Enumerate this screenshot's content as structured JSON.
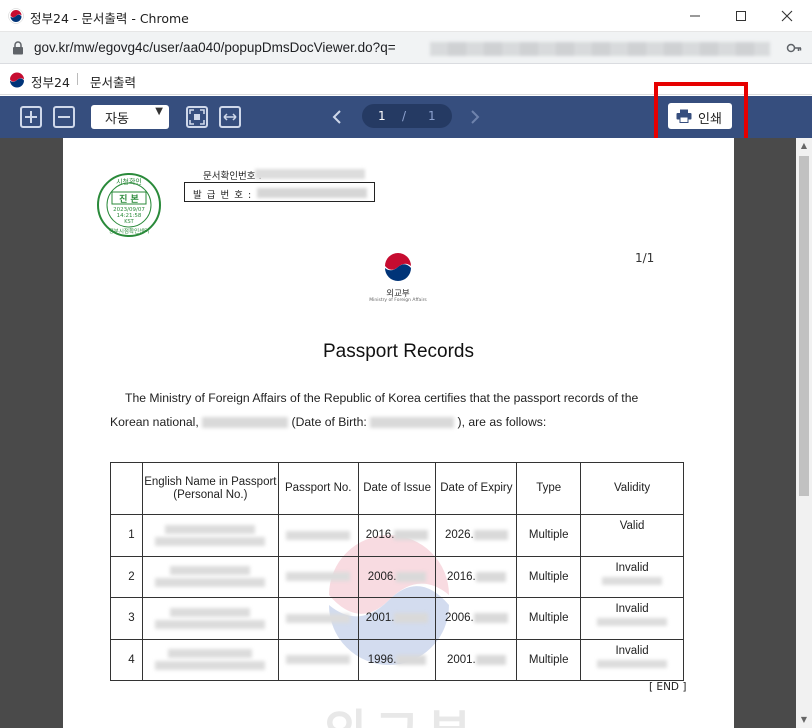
{
  "window": {
    "title": "정부24 - 문서출력 - Chrome",
    "controls": [
      "minimize",
      "maximize",
      "close"
    ]
  },
  "address": {
    "url": "gov.kr/mw/egovg4c/user/aa040/popupDmsDocViewer.do?q="
  },
  "header": {
    "site": "정부24",
    "page": "문서출력"
  },
  "toolbar": {
    "zoom": "자동",
    "current_page": "1",
    "page_sep": "/",
    "total_pages": "1",
    "print_label": "인쇄"
  },
  "document": {
    "seal": {
      "top_text": "시청확인",
      "center": "진 본",
      "date": "2023/09/07",
      "time": "14:21:58",
      "zone": "KST",
      "bottom_text": "정부시점확인센터"
    },
    "doc_confirm_label": "문서확인번호 :",
    "issue_label": "발 급 번 호 :",
    "page_indicator": "1/1",
    "ministry_ko": "외교부",
    "ministry_en": "Ministry of Foreign Affairs",
    "title": "Passport Records",
    "para1": "The Ministry of Foreign Affairs of the Republic of Korea certifies that the passport records of the",
    "para2_a": "Korean national,",
    "para2_b": "(Date of Birth:",
    "para2_c": "), are as follows:",
    "table": {
      "headers": [
        "",
        "English Name in Passport (Personal No.)",
        "Passport No.",
        "Date of Issue",
        "Date of Expiry",
        "Type",
        "Validity"
      ],
      "rows": [
        {
          "no": "1",
          "issue": "2016.",
          "expiry": "2026.",
          "type": "Multiple",
          "validity": "Valid"
        },
        {
          "no": "2",
          "issue": "2006.",
          "expiry": "2016.",
          "type": "Multiple",
          "validity": "Invalid"
        },
        {
          "no": "3",
          "issue": "2001.",
          "expiry": "2006.",
          "type": "Multiple",
          "validity": "Invalid"
        },
        {
          "no": "4",
          "issue": "1996.",
          "expiry": "2001.",
          "type": "Multiple",
          "validity": "Invalid"
        }
      ]
    },
    "end_mark": "[ END ]",
    "watermark": "외교부"
  }
}
